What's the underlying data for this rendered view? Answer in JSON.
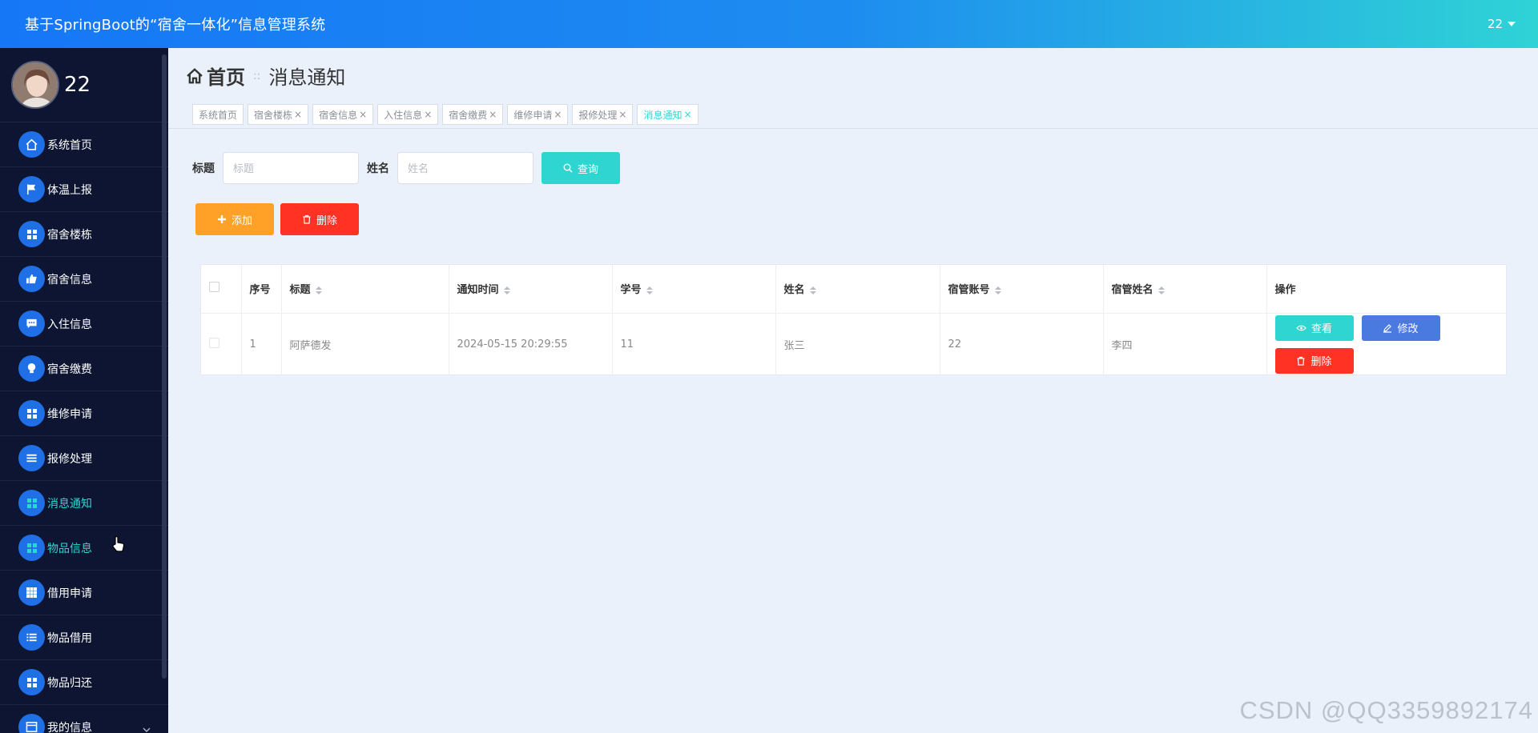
{
  "header": {
    "title": "基于SpringBoot的“宿舍一体化”信息管理系统",
    "user": "22"
  },
  "sidebar": {
    "profile_name": "22",
    "items": [
      {
        "label": "系统首页",
        "icon": "home-icon"
      },
      {
        "label": "体温上报",
        "icon": "flag-icon"
      },
      {
        "label": "宿舍楼栋",
        "icon": "grid-icon"
      },
      {
        "label": "宿舍信息",
        "icon": "thumbs-up-icon"
      },
      {
        "label": "入住信息",
        "icon": "chat-icon"
      },
      {
        "label": "宿舍缴费",
        "icon": "bulb-icon"
      },
      {
        "label": "维修申请",
        "icon": "grid-icon"
      },
      {
        "label": "报修处理",
        "icon": "list-icon"
      },
      {
        "label": "消息通知",
        "icon": "grid-icon"
      },
      {
        "label": "物品信息",
        "icon": "grid-icon"
      },
      {
        "label": "借用申请",
        "icon": "table-icon"
      },
      {
        "label": "物品借用",
        "icon": "list-icon"
      },
      {
        "label": "物品归还",
        "icon": "grid-icon"
      },
      {
        "label": "我的信息",
        "icon": "card-icon"
      }
    ],
    "active_index": 8
  },
  "breadcrumb": {
    "home": "首页",
    "separator": "::",
    "current": "消息通知"
  },
  "tabs": [
    {
      "label": "系统首页",
      "closable": false
    },
    {
      "label": "宿舍楼栋",
      "closable": true
    },
    {
      "label": "宿舍信息",
      "closable": true
    },
    {
      "label": "入住信息",
      "closable": true
    },
    {
      "label": "宿舍缴费",
      "closable": true
    },
    {
      "label": "维修申请",
      "closable": true
    },
    {
      "label": "报修处理",
      "closable": true
    },
    {
      "label": "消息通知",
      "closable": true,
      "active": true
    }
  ],
  "search": {
    "title_label": "标题",
    "title_placeholder": "标题",
    "name_label": "姓名",
    "name_placeholder": "姓名",
    "query_button": "查询"
  },
  "actions": {
    "add_button": "添加",
    "delete_button": "删除"
  },
  "table": {
    "columns": [
      "序号",
      "标题",
      "通知时间",
      "学号",
      "姓名",
      "宿管账号",
      "宿管姓名",
      "操作"
    ],
    "rows": [
      {
        "index": "1",
        "title": "阿萨德发",
        "time": "2024-05-15 20:29:55",
        "student_id": "11",
        "name": "张三",
        "manager_account": "22",
        "manager_name": "李四"
      }
    ],
    "row_actions": {
      "view": "查看",
      "edit": "修改",
      "delete": "删除"
    }
  },
  "watermark": "CSDN @QQ3359892174",
  "colors": {
    "accent": "#2fd6d1",
    "primary": "#1f6fe6",
    "sidebar_bg": "#0d1532",
    "warning": "#ffa127",
    "danger": "#ff3224",
    "edit": "#4a7ae0"
  }
}
